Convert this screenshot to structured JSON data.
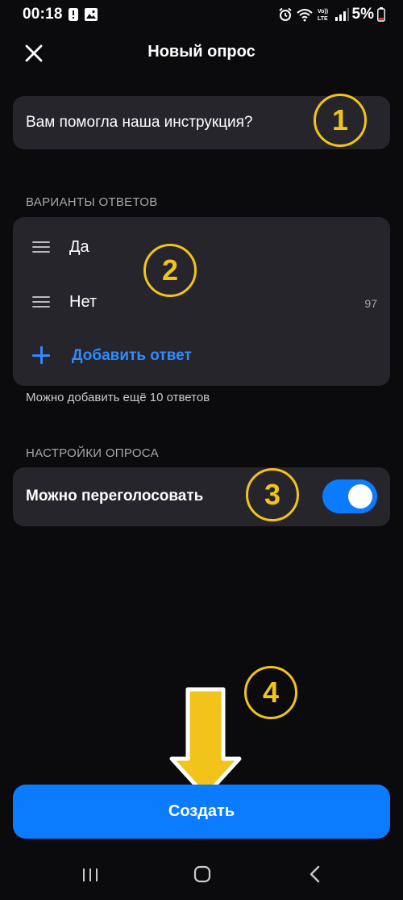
{
  "status_bar": {
    "time": "00:18",
    "battery_text": "5%",
    "icons": [
      "alert-icon",
      "gallery-icon",
      "alarm-icon",
      "wifi-icon",
      "volte-icon",
      "signal-icon",
      "battery-icon"
    ]
  },
  "header": {
    "title": "Новый опрос",
    "close_icon": "close-icon"
  },
  "question": {
    "value": "Вам помогла наша инструкция?"
  },
  "answers": {
    "section_label": "ВАРИАНТЫ ОТВЕТОВ",
    "items": [
      {
        "label": "Да",
        "counter": ""
      },
      {
        "label": "Нет",
        "counter": "97"
      }
    ],
    "add_label": "Добавить ответ",
    "hint": "Можно добавить ещё 10 ответов"
  },
  "settings": {
    "section_label": "НАСТРОЙКИ ОПРОСА",
    "revote_label": "Можно переголосовать",
    "revote_enabled": true
  },
  "annotations": {
    "step_1": "1",
    "step_2": "2",
    "step_3": "3",
    "step_4": "4"
  },
  "create_button": {
    "label": "Создать"
  },
  "nav_bar": {
    "icons": [
      "recents-icon",
      "home-icon",
      "back-icon"
    ]
  },
  "colors": {
    "background": "#0b0b0d",
    "card": "#25252b",
    "accent": "#0b7bff",
    "link": "#2f8cff",
    "annotation": "#f2c31b",
    "muted_text": "#a7a8ae"
  }
}
